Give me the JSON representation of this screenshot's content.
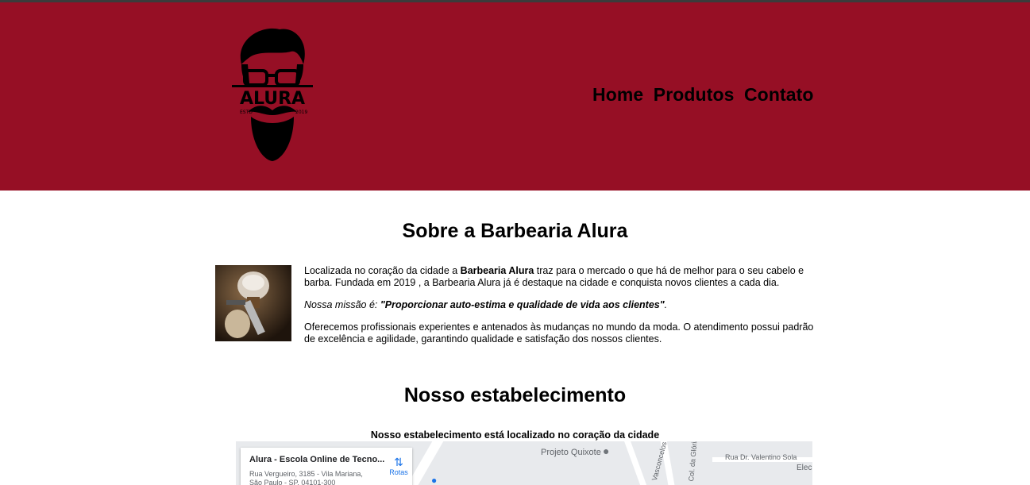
{
  "header": {
    "logo_alt": "ALURA",
    "logo_est": "ESTD",
    "logo_year": "2019",
    "nav": [
      "Home",
      "Produtos",
      "Contato"
    ]
  },
  "about": {
    "title": "Sobre a Barbearia Alura",
    "p1_a": "Localizada no coração da cidade a ",
    "p1_b": "Barbearia Alura",
    "p1_c": " traz para o mercado o que há de melhor para o seu cabelo e barba. Fundada em 2019 , a Barbearia Alura já é destaque na cidade e conquista novos clientes a cada dia.",
    "mission_a": "Nossa missão é: ",
    "mission_b": "\"Proporcionar auto-estima e qualidade de vida aos clientes\"",
    "mission_c": ".",
    "p3": "Oferecemos profissionais experientes e antenados às mudanças no mundo da moda. O atendimento possui padrão de excelência e agilidade, garantindo qualidade e satisfação dos nossos clientes."
  },
  "establishment": {
    "title": "Nosso estabelecimento",
    "subtitle": "Nosso estabelecimento está localizado no coração da cidade"
  },
  "map": {
    "place_name": "Alura - Escola Online de Tecno...",
    "address_line1": "Rua Vergueiro, 3185 - Vila Mariana,",
    "address_line2": "São Paulo - SP, 04101-300",
    "route_label": "Rotas",
    "labels": {
      "projeto": "Projeto Quixote",
      "vasconcelos": "Vasconcelos",
      "gloria": "Col. da Glória",
      "valentino": "Rua Dr. Valentino Sola",
      "elec": "Elec"
    }
  }
}
